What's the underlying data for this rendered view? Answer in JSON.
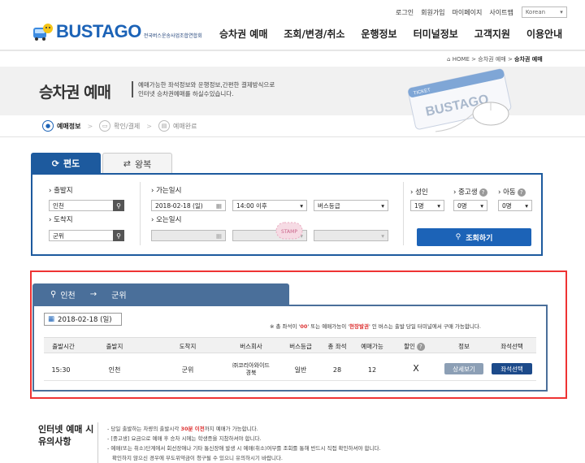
{
  "header": {
    "util_links": [
      "로그인",
      "회원가입",
      "마이페이지",
      "사이트맵"
    ],
    "language": "Korean",
    "brand": "BUSTAGO",
    "brand_sub": "전국버스운송사업조합연합회",
    "nav": [
      "승차권 예매",
      "조회/변경/취소",
      "운행정보",
      "터미널정보",
      "고객지원",
      "이용안내"
    ]
  },
  "breadcrumb": {
    "home": "HOME",
    "parent": "승차권 예매",
    "current": "승차권 예매"
  },
  "page": {
    "title": "승차권 예매",
    "desc_line1": "예매가능한 좌석정보와 운행정보,간편한 결제방식으로",
    "desc_line2": "인터넷 승차권예매를 하실수있습니다.",
    "ticket_brand": "BUSTAGO",
    "ticket_label": "TICKET"
  },
  "steps": [
    "예매정보",
    "확인/결제",
    "예매완료"
  ],
  "search": {
    "tab_oneway": "편도",
    "tab_round": "왕복",
    "depart_label": "출발지",
    "depart_value": "인천",
    "arrive_label": "도착지",
    "arrive_value": "군위",
    "go_label": "가는일시",
    "go_date": "2018-02-18 (일)",
    "go_time": "14:00 이후",
    "bus_grade": "버스등급",
    "return_label": "오는일시",
    "adult_label": "성인",
    "adult_value": "1명",
    "teen_label": "중고생",
    "teen_value": "0명",
    "child_label": "아동",
    "child_value": "0명",
    "submit_label": "조회하기",
    "stamp": "STAMP"
  },
  "result": {
    "route_from": "인천",
    "route_arrow": "→",
    "route_to": "군위",
    "date": "2018-02-18 (일)",
    "notice_prefix": "※ 총 좌석이 '",
    "notice_zero": "00",
    "notice_mid": "' 또는 예매가능이 '",
    "notice_onsite": "현장발권",
    "notice_suffix": "' 인 버스는 출발 당일 터미널에서 구매 가능합니다.",
    "columns": [
      "출발시간",
      "출발지",
      "도착지",
      "버스회사",
      "버스등급",
      "총 좌석",
      "예매가능",
      "할인",
      "정보",
      "좌석선택"
    ],
    "rows": [
      {
        "time": "15:30",
        "from": "인천",
        "to": "군위",
        "company_line1": "㈜코리아와이드",
        "company_line2": "경북",
        "grade": "일반",
        "total": "28",
        "available": "12",
        "discount": "X",
        "detail_label": "상세보기",
        "select_label": "좌석선택"
      }
    ]
  },
  "notes": {
    "title_line1": "인터넷 예매 시",
    "title_line2": "유의사항",
    "n1_pre": "- 당일 출발하는 차량의 출발시각 ",
    "n1_red": "30분 이전",
    "n1_post": "까지 예매가 가능합니다.",
    "n2": "- [중고생] 요금으로 예매 후 승차 시에는 학생증을 지참하셔야 합니다.",
    "n3": "- 예매(또는 취소)단계에서 회선장애나 기타 통신장애 발생 시 예매(취소)여부를 조회를 통해 반드시 직접 확인하셔야 합니다.",
    "n4": "확인하지 않으신 경우에 부도위약금이 청구될 수 있으니 유의하시기 바랍니다."
  },
  "colors": {
    "primary": "#1c63b7",
    "tab_active": "#1d5a9e",
    "result_tab": "#4a6f9a",
    "highlight_red": "#e33333"
  }
}
